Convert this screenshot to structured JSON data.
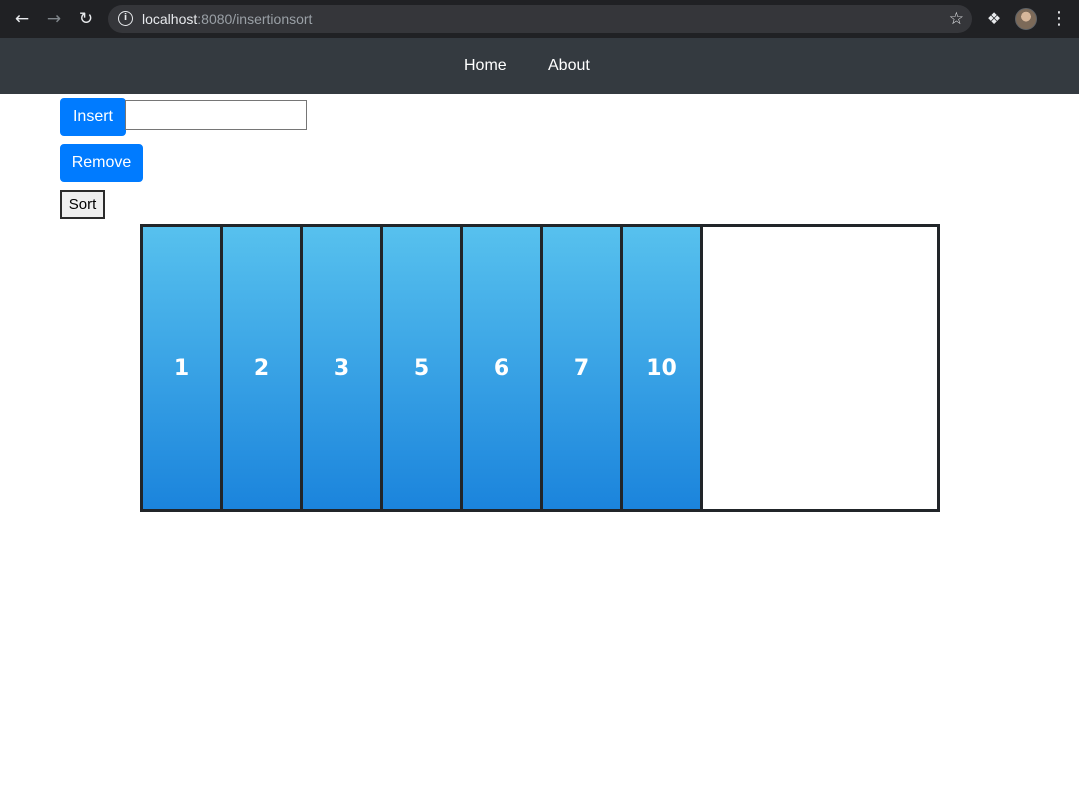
{
  "browser": {
    "url_host": "localhost",
    "url_rest": ":8080/insertionsort"
  },
  "navbar": {
    "links": [
      "Home",
      "About"
    ]
  },
  "controls": {
    "insert_label": "Insert",
    "insert_value": "",
    "remove_label": "Remove",
    "sort_label": "Sort"
  },
  "array": {
    "values": [
      "1",
      "2",
      "3",
      "5",
      "6",
      "7",
      "10"
    ]
  },
  "colors": {
    "primary": "#007bff",
    "navbar": "#343a40",
    "cell_top": "#57c1ee",
    "cell_bottom": "#1b84dc"
  }
}
